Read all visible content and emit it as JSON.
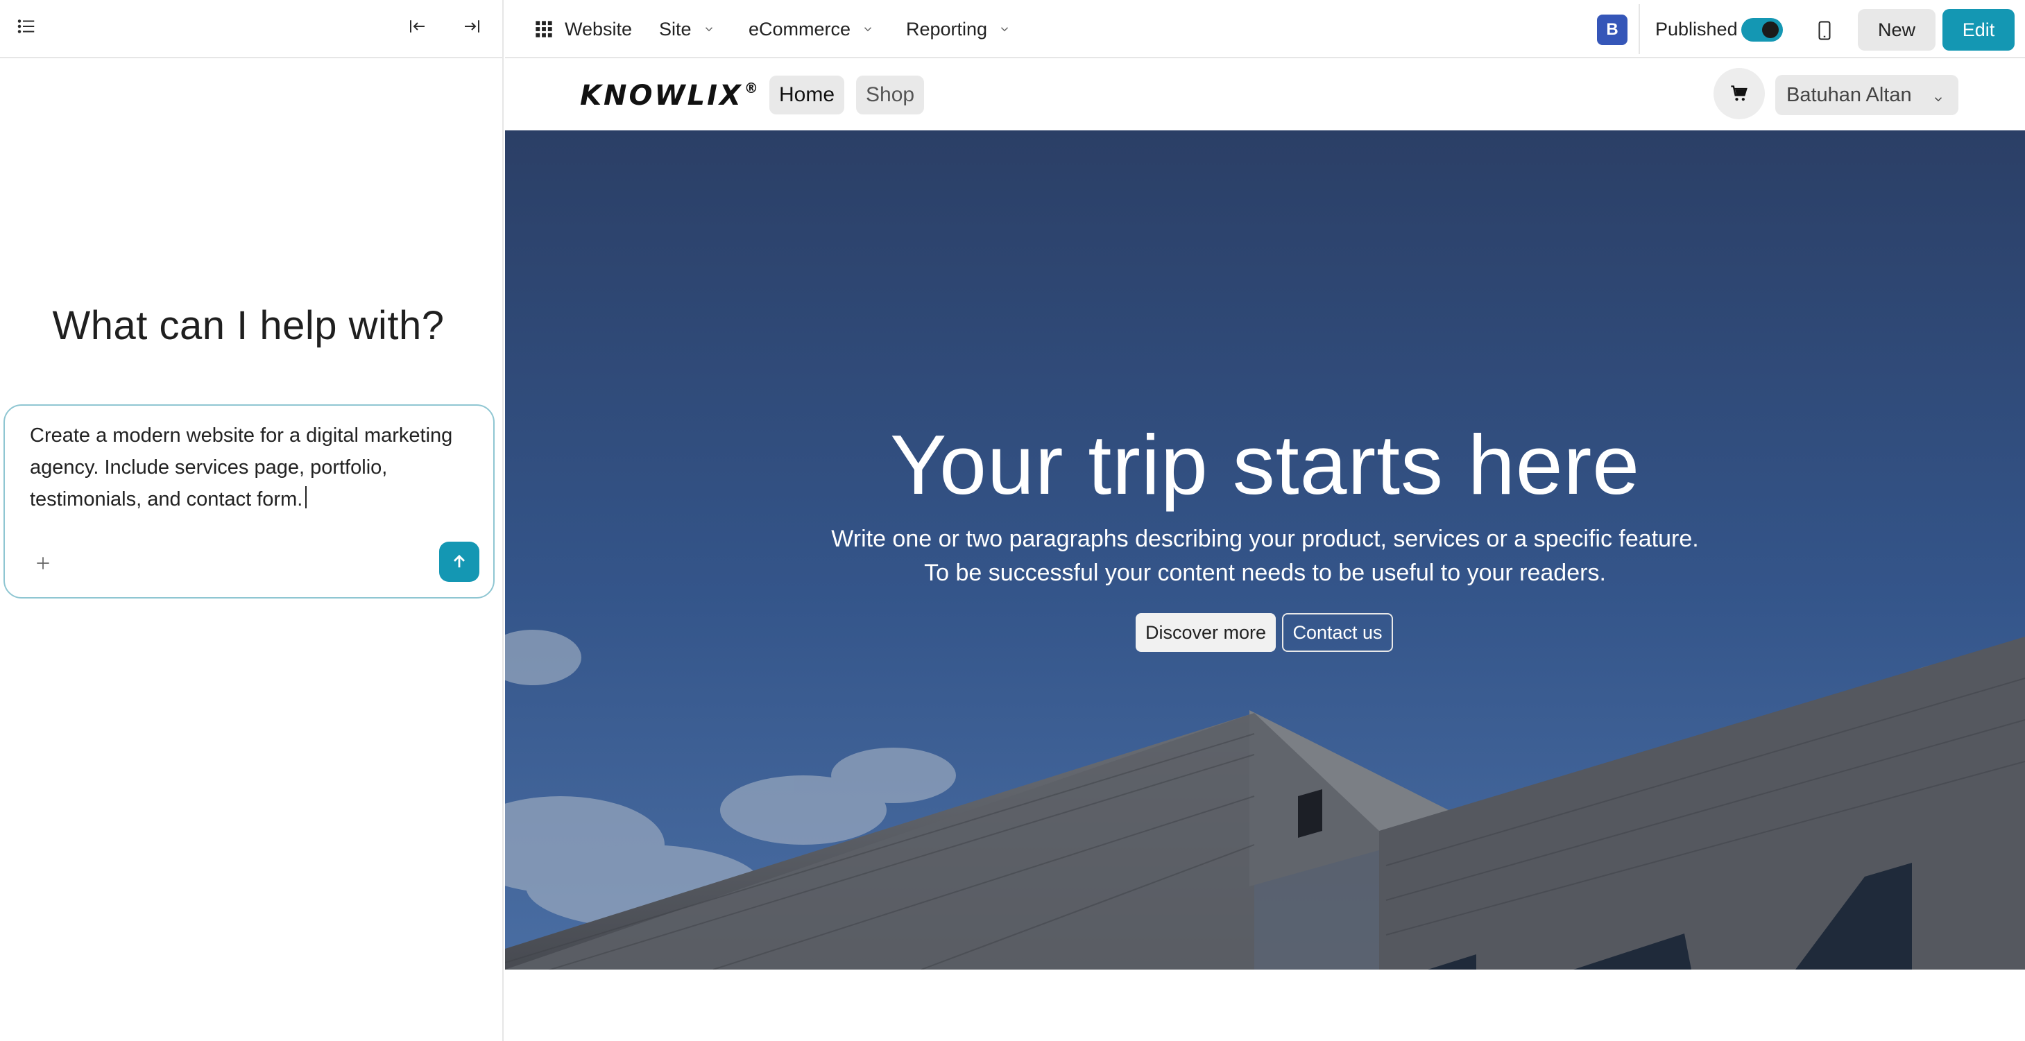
{
  "assistant": {
    "heading": "What can I help with?",
    "prompt_value": "Create a modern website for a digital marketing agency. Include services page, portfolio, testimonials, and contact form.",
    "icons": [
      "list-icon",
      "collapse-left-icon",
      "expand-right-icon",
      "plus-icon",
      "arrow-up-icon"
    ]
  },
  "topbar": {
    "app_name": "Website",
    "menus": [
      "Site",
      "eCommerce",
      "Reporting"
    ],
    "avatar_initial": "B",
    "published_label": "Published",
    "published_on": true,
    "new_label": "New",
    "edit_label": "Edit"
  },
  "site": {
    "logo": "KNOWLIX",
    "logo_mark": "®",
    "nav": [
      "Home",
      "Shop"
    ],
    "active_nav": "Home",
    "user_name": "Batuhan Altan"
  },
  "hero": {
    "title": "Your trip starts here",
    "subtitle_line1": "Write one or two paragraphs describing your product, services or a specific feature.",
    "subtitle_line2": "To be successful your content needs to be useful to your readers.",
    "primary_button": "Discover more",
    "secondary_button": "Contact us"
  },
  "colors": {
    "accent": "#1497b3",
    "avatar": "#3556b8",
    "hero_sky": "#2f4a77"
  }
}
